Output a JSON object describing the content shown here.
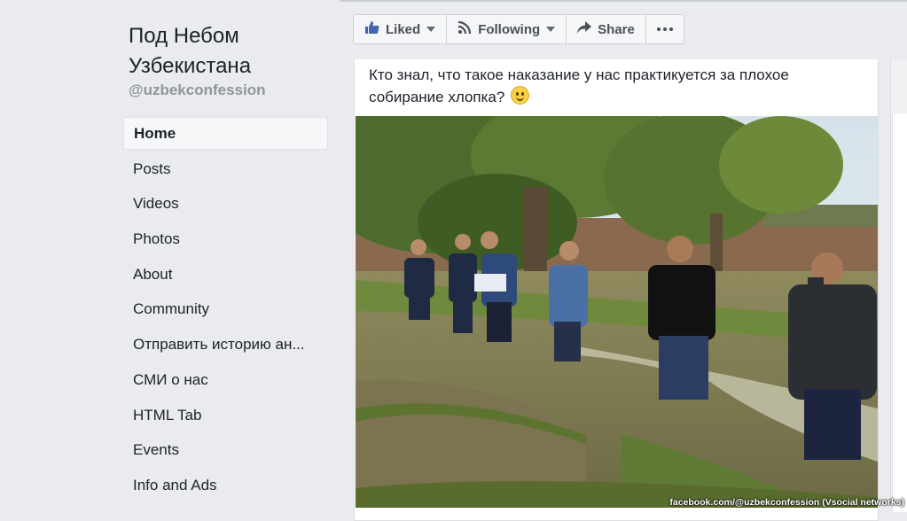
{
  "page": {
    "name": "Под Небом Узбекистана",
    "handle": "@uzbekconfession"
  },
  "nav": {
    "items": [
      {
        "label": "Home",
        "active": true
      },
      {
        "label": "Posts"
      },
      {
        "label": "Videos"
      },
      {
        "label": "Photos"
      },
      {
        "label": "About"
      },
      {
        "label": "Community"
      },
      {
        "label": "Отправить историю ан..."
      },
      {
        "label": "СМИ о нас"
      },
      {
        "label": "HTML Tab"
      },
      {
        "label": "Events"
      },
      {
        "label": "Info and Ads"
      }
    ]
  },
  "actions": {
    "liked": "Liked",
    "following": "Following",
    "share": "Share"
  },
  "icons": {
    "liked": "thumbs-up-icon",
    "following": "rss-icon",
    "share": "share-arrow-icon",
    "more": "more-dots-icon",
    "emoji": "smiley-icon"
  },
  "post": {
    "text": "Кто знал, что такое наказание у нас практикуется за плохое собирание хлопка?"
  },
  "credit": "facebook.com/@uzbekconfession (Vsocial networks)",
  "colors": {
    "background": "#e9ebee",
    "liked_icon": "#4267b2",
    "text_secondary": "#90949c"
  }
}
